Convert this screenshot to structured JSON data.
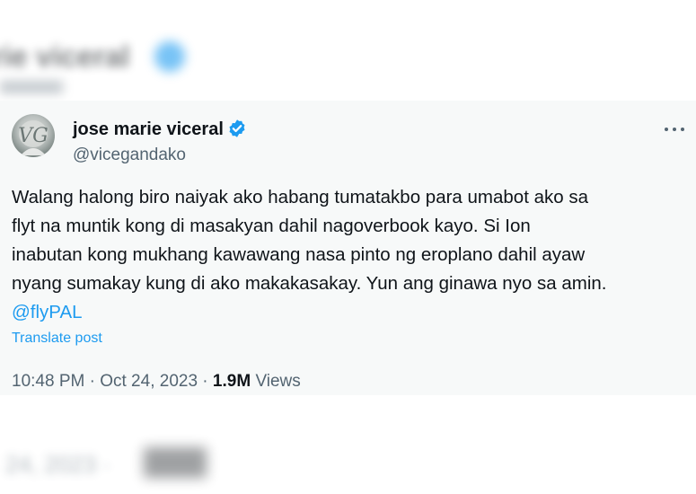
{
  "background_top": {
    "blurred_text": "arie viceral"
  },
  "tweet": {
    "author": {
      "display_name": "jose marie viceral",
      "handle": "@vicegandako",
      "verified": true
    },
    "text_lines": [
      "Walang halong biro naiyak ako habang tumatakbo para umabot ako sa",
      "flyt na muntik kong di masakyan dahil nagoverbook kayo. Si Ion",
      "inabutan kong mukhang kawawang nasa pinto ng eroplano dahil ayaw",
      "nyang sumakay kung di ako makakasakay. Yun ang ginawa nyo sa amin."
    ],
    "mention": "@flyPAL",
    "translate_label": "Translate post",
    "time": "10:48 PM",
    "date": "Oct 24, 2023",
    "separator": "·",
    "views_count": "1.9M",
    "views_label": "Views"
  },
  "background_bottom": {
    "blurred_text": "24, 2023 ·"
  },
  "colors": {
    "accent": "#1d9bf0",
    "text_primary": "#0f1419",
    "text_secondary": "#536471",
    "card_background": "#f7f9f9"
  },
  "icons": {
    "verified": "verified-badge-icon",
    "more": "more-horizontal-icon"
  }
}
